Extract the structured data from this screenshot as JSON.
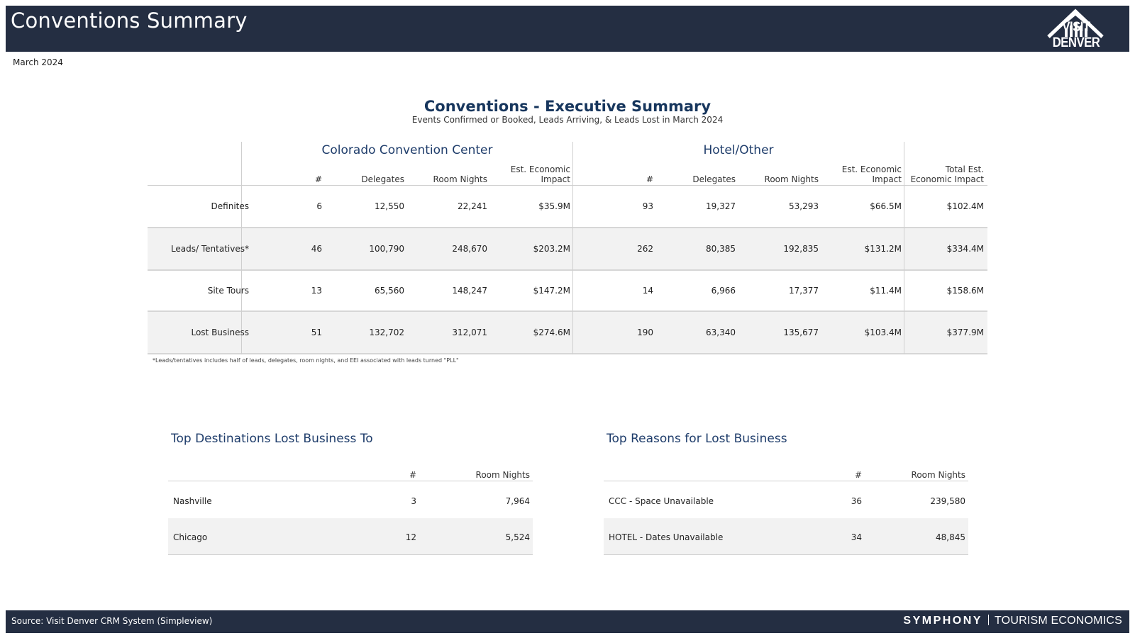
{
  "header": {
    "title": "Conventions Summary",
    "logo_text": "VISIT DENVER",
    "period": "March 2024",
    "colors": {
      "bar": "#242e42",
      "title_blue": "#17365d",
      "shade": "#f2f2f2"
    }
  },
  "summary": {
    "title": "Conventions - Executive Summary",
    "subtitle": "Events Confirmed or Booked, Leads Arriving, & Leads Lost in March 2024",
    "groups": {
      "ccc": "Colorado Convention Center",
      "hotel": "Hotel/Other"
    },
    "columns": {
      "count": "#",
      "delegates": "Delegates",
      "room_nights": "Room Nights",
      "eei_line1": "Est. Economic",
      "eei_line2": "Impact",
      "total_line1": "Total Est.",
      "total_line2": "Economic Impact"
    },
    "rows": [
      {
        "label": "Definites",
        "ccc": [
          "6",
          "12,550",
          "22,241",
          "$35.9M"
        ],
        "hotel": [
          "93",
          "19,327",
          "53,293",
          "$66.5M"
        ],
        "total": "$102.4M"
      },
      {
        "label": "Leads/ Tentatives*",
        "ccc": [
          "46",
          "100,790",
          "248,670",
          "$203.2M"
        ],
        "hotel": [
          "262",
          "80,385",
          "192,835",
          "$131.2M"
        ],
        "total": "$334.4M"
      },
      {
        "label": "Site Tours",
        "ccc": [
          "13",
          "65,560",
          "148,247",
          "$147.2M"
        ],
        "hotel": [
          "14",
          "6,966",
          "17,377",
          "$11.4M"
        ],
        "total": "$158.6M"
      },
      {
        "label": "Lost Business",
        "ccc": [
          "51",
          "132,702",
          "312,071",
          "$274.6M"
        ],
        "hotel": [
          "190",
          "63,340",
          "135,677",
          "$103.4M"
        ],
        "total": "$377.9M"
      }
    ],
    "footnote": "*Leads/tentatives includes half of leads, delegates, room nights, and EEI associated with leads turned \"PLL\""
  },
  "destinations": {
    "title": "Top Destinations Lost Business To",
    "col_count": "#",
    "col_room_nights": "Room Nights",
    "rows": [
      {
        "name": "Nashville",
        "count": "3",
        "room_nights": "7,964"
      },
      {
        "name": "Chicago",
        "count": "12",
        "room_nights": "5,524"
      }
    ]
  },
  "reasons": {
    "title": "Top Reasons for Lost Business",
    "col_count": "#",
    "col_room_nights": "Room Nights",
    "rows": [
      {
        "name": "CCC - Space Unavailable",
        "count": "36",
        "room_nights": "239,580"
      },
      {
        "name": "HOTEL - Dates Unavailable",
        "count": "34",
        "room_nights": "48,845"
      }
    ]
  },
  "footer": {
    "source": "Source: Visit Denver CRM System (Simpleview)",
    "brand_primary": "SYMPHONY",
    "brand_secondary": "TOURISM ECONOMICS"
  }
}
